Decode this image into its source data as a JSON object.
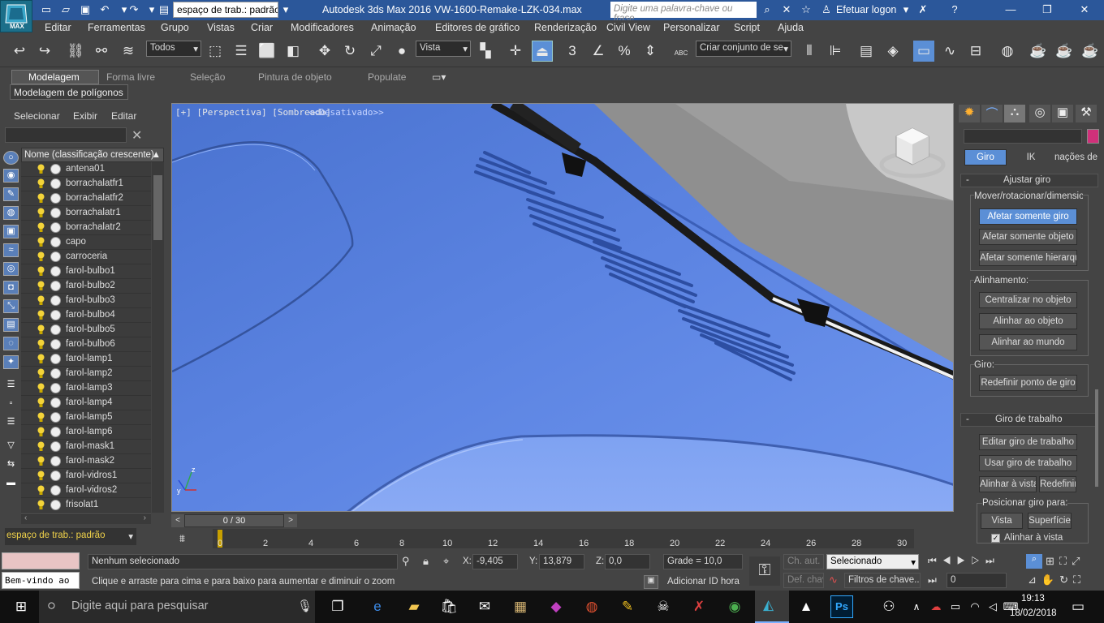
{
  "titlebar": {
    "app_title": "Autodesk 3ds Max 2016",
    "file_title": "VW-1600-Remake-LZK-034.max",
    "workspace_dropdown": "espaço de trab.: padrão",
    "search_placeholder": "Digite uma palavra-chave ou frase",
    "login_label": "Efetuar logon",
    "logo_text": "MAX"
  },
  "menubar": [
    "Editar",
    "Ferramentas",
    "Grupo",
    "Vistas",
    "Criar",
    "Modificadores",
    "Animação",
    "Editores de gráfico",
    "Renderização",
    "Civil View",
    "Personalizar",
    "Script",
    "Ajuda"
  ],
  "toolbar": {
    "selection_filter": "Todos",
    "reference_coord": "Vista",
    "snaps_label": "3",
    "named_selection_placeholder": "Criar conjunto de se",
    "abc_label": "ABC"
  },
  "ribbon": {
    "tabs": [
      "Modelagem",
      "Forma livre",
      "Seleção",
      "Pintura de objeto",
      "Populate"
    ],
    "active_tab": "Modelagem",
    "subtab": "Modelagem de polígonos"
  },
  "scene_explorer": {
    "menu": [
      "Selecionar",
      "Exibir",
      "Editar"
    ],
    "column_header": "Nome (classificação crescente)",
    "items": [
      "antena01",
      "borrachalatfr1",
      "borrachalatfr2",
      "borrachalatr1",
      "borrachalatr2",
      "capo",
      "carroceria",
      "farol-bulbo1",
      "farol-bulbo2",
      "farol-bulbo3",
      "farol-bulbo4",
      "farol-bulbo5",
      "farol-bulbo6",
      "farol-lamp1",
      "farol-lamp2",
      "farol-lamp3",
      "farol-lamp4",
      "farol-lamp5",
      "farol-lamp6",
      "farol-mask1",
      "farol-mask2",
      "farol-vidros1",
      "farol-vidros2",
      "frisolat1"
    ],
    "workspace_label": "espaço de trab.: padrão"
  },
  "viewport": {
    "label": "[+] [Perspectiva] [Sombreado]",
    "label_disabled": "<<Desativado>>",
    "axis_z": "z",
    "axis_y": "y",
    "axis_x": "x",
    "body_color": "#5a80d8"
  },
  "command_panel": {
    "tabs": [
      "Giro",
      "IK",
      "nações de v"
    ],
    "active_tab": "Giro",
    "rollout_adjust": "Ajustar giro",
    "group_move": "Mover/rotacionar/dimensionar",
    "btn_affect_pivot": "Afetar somente giro",
    "btn_affect_object": "Afetar somente objeto",
    "btn_affect_hierarchy": "Afetar somente hierarquia",
    "group_align": "Alinhamento:",
    "btn_center": "Centralizar no objeto",
    "btn_align_object": "Alinhar ao objeto",
    "btn_align_world": "Alinhar ao mundo",
    "group_pivot": "Giro:",
    "btn_reset_pivot": "Redefinir ponto de giro",
    "rollout_working": "Giro de trabalho",
    "btn_edit_working": "Editar giro de trabalho",
    "btn_use_working": "Usar giro de trabalho",
    "btn_align_view": "Alinhar à vista",
    "btn_reset": "Redefinir",
    "group_place": "Posicionar giro para:",
    "btn_view": "Vista",
    "btn_surface": "Superfície",
    "chk_align_view": "Alinhar à vista",
    "color_swatch": "#d0307a"
  },
  "timeline": {
    "frame_counter": "0 / 30",
    "ticks": [
      "0",
      "2",
      "4",
      "6",
      "8",
      "10",
      "12",
      "14",
      "16",
      "18",
      "20",
      "22",
      "24",
      "26",
      "28",
      "30"
    ]
  },
  "statusbar": {
    "selection_status": "Nenhum selecionado",
    "prompt": "Clique e arraste para cima e para baixo para aumentar e diminuir o zoom",
    "welcome": "Bem-vindo ao",
    "x_label": "X:",
    "x_value": "-9,405",
    "y_label": "Y:",
    "y_value": "13,879",
    "z_label": "Z:",
    "z_value": "0,0",
    "grid": "Grade = 10,0",
    "add_time_tag": "Adicionar ID hora",
    "auto_key": "Ch. aut.",
    "set_key": "Def. chave",
    "key_mode": "Selecionado",
    "key_filters": "Filtros de chave...",
    "frame_field": "0"
  },
  "taskbar": {
    "search_placeholder": "Digite aqui para pesquisar",
    "time": "19:13",
    "date": "18/02/2018"
  }
}
